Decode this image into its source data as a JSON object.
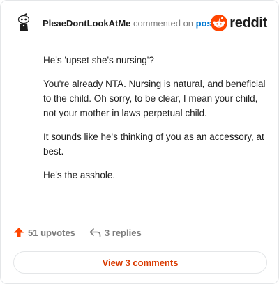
{
  "header": {
    "username": "PleaeDontLookAtMe",
    "commented_on": "commented on",
    "post_link": "post",
    "brand_name": "reddit"
  },
  "comment": {
    "paragraphs": [
      "He's 'upset she's nursing'?",
      "You're already NTA. Nursing is natural, and beneficial to the child. Oh sorry, to be clear, I mean your child, not your mother in laws perpetual child.",
      "It sounds like he's thinking of you as an accessory, at best.",
      "He's the asshole."
    ]
  },
  "actions": {
    "upvotes": "51 upvotes",
    "replies": "3 replies"
  },
  "footer": {
    "view_comments": "View 3 comments"
  },
  "colors": {
    "brand": "#ff4500",
    "link": "#0079d3",
    "view_button_text": "#d93a00"
  },
  "icons": {
    "avatar": "snoo-avatar",
    "logo": "reddit-logo-icon",
    "upvote": "upvote-arrow-icon",
    "reply": "reply-arrow-icon"
  }
}
